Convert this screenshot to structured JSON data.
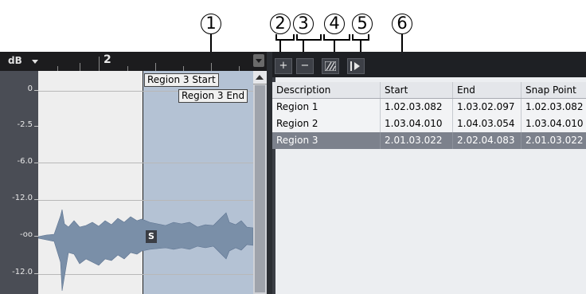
{
  "callouts": [
    "1",
    "2",
    "3",
    "4",
    "5",
    "6"
  ],
  "editor": {
    "db_label": "dB",
    "ruler_bar": "2",
    "scale_labels": [
      "0",
      "-2.5",
      "-6.0",
      "-12.0",
      "-oo",
      "-12.0"
    ],
    "region_start_label": "Region 3 Start",
    "region_end_label": "Region 3 End",
    "snap_label": "S"
  },
  "toolbar": {
    "add_label": "+",
    "remove_label": "−"
  },
  "table": {
    "columns": [
      "Description",
      "Start",
      "End",
      "Snap Point"
    ],
    "rows": [
      {
        "description": "Region 1",
        "start": "1.02.03.082",
        "end": "1.03.02.097",
        "snap": "1.02.03.082",
        "selected": false
      },
      {
        "description": "Region 2",
        "start": "1.03.04.010",
        "end": "1.04.03.054",
        "snap": "1.03.04.010",
        "selected": false
      },
      {
        "description": "Region 3",
        "start": "2.01.03.022",
        "end": "2.02.04.083",
        "snap": "2.01.03.022",
        "selected": true
      }
    ]
  },
  "colors": {
    "selected_row": "#7c818c",
    "region": "#b4c2d4",
    "waveform": "#7a8fa8",
    "toolbar": "#1e2024"
  }
}
